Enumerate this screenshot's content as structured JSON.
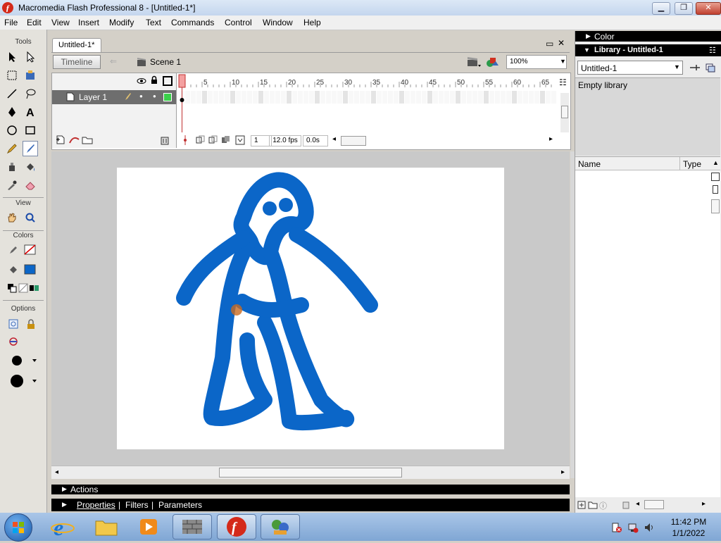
{
  "window": {
    "title": "Macromedia Flash Professional 8 - [Untitled-1*]"
  },
  "menu": [
    "File",
    "Edit",
    "View",
    "Insert",
    "Modify",
    "Text",
    "Commands",
    "Control",
    "Window",
    "Help"
  ],
  "tools_panel": {
    "title": "Tools",
    "view_label": "View",
    "colors_label": "Colors",
    "options_label": "Options"
  },
  "document": {
    "tab_label": "Untitled-1*",
    "timeline_button": "Timeline",
    "scene_label": "Scene 1",
    "zoom": "100%"
  },
  "timeline": {
    "layer_name": "Layer 1",
    "frame_ticks": [
      "1",
      "5",
      "10",
      "15",
      "20",
      "25",
      "30",
      "35",
      "40",
      "45",
      "50",
      "55",
      "60",
      "65"
    ],
    "current_frame": "1",
    "fps": "12.0 fps",
    "time": "0.0s"
  },
  "panels": {
    "actions": "Actions",
    "properties": "Properties",
    "filters": "Filters",
    "parameters": "Parameters"
  },
  "right_panels": {
    "color_title": "Color",
    "library_title": "Library - Untitled-1",
    "library_select": "Untitled-1",
    "empty_text": "Empty library",
    "col_name": "Name",
    "col_type": "Type"
  },
  "taskbar": {
    "time": "11:42 PM",
    "date": "1/1/2022"
  },
  "colors": {
    "stroke_blue": "#0b66c8",
    "flash_red": "#d42a1a"
  }
}
